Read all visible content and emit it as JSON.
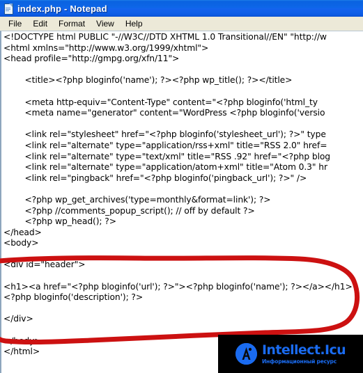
{
  "window": {
    "title": "index.php - Notepad",
    "icon": "notepad-document-icon",
    "titlebar_color": "#0d66e8",
    "titlebar_text_color": "#ffffff",
    "menubar_color": "#ece9d8"
  },
  "menubar": {
    "items": [
      {
        "label": "File"
      },
      {
        "label": "Edit"
      },
      {
        "label": "Format"
      },
      {
        "label": "View"
      },
      {
        "label": "Help"
      }
    ]
  },
  "editor": {
    "background": "#ffffff",
    "text_color": "#000000",
    "content": "<!DOCTYPE html PUBLIC \"-//W3C//DTD XHTML 1.0 Transitional//EN\" \"http://w\n<html xmlns=\"http://www.w3.org/1999/xhtml\">\n<head profile=\"http://gmpg.org/xfn/11\">\n\n        <title><?php bloginfo('name'); ?><?php wp_title(); ?></title>\n\n        <meta http-equiv=\"Content-Type\" content=\"<?php bloginfo('html_ty\n        <meta name=\"generator\" content=\"WordPress <?php bloginfo('versio\n\n        <link rel=\"stylesheet\" href=\"<?php bloginfo('stylesheet_url'); ?>\" type\n        <link rel=\"alternate\" type=\"application/rss+xml\" title=\"RSS 2.0\" href=\n        <link rel=\"alternate\" type=\"text/xml\" title=\"RSS .92\" href=\"<?php blog\n        <link rel=\"alternate\" type=\"application/atom+xml\" title=\"Atom 0.3\" hr\n        <link rel=\"pingback\" href=\"<?php bloginfo('pingback_url'); ?>\" />\n\n        <?php wp_get_archives('type=monthly&format=link'); ?>\n        <?php //comments_popup_script(); // off by default ?>\n        <?php wp_head(); ?>\n</head>\n<body>\n\n<div id=\"header\">\n\n<h1><a href=\"<?php bloginfo('url'); ?>\"><?php bloginfo('name'); ?></a></h1>\n<?php bloginfo('description'); ?>\n\n</div>\n\n</body>\n</html>"
  },
  "annotation": {
    "shape": "hand-drawn-ellipse",
    "color": "#cc1111",
    "encircles": "header-div-block"
  },
  "watermark": {
    "title": "Intellect.Icu",
    "subtitle": "Информационный ресурс",
    "logo": "circle-a-monogram-logo",
    "background": "#000000",
    "accent_color": "#1a6bf0"
  }
}
